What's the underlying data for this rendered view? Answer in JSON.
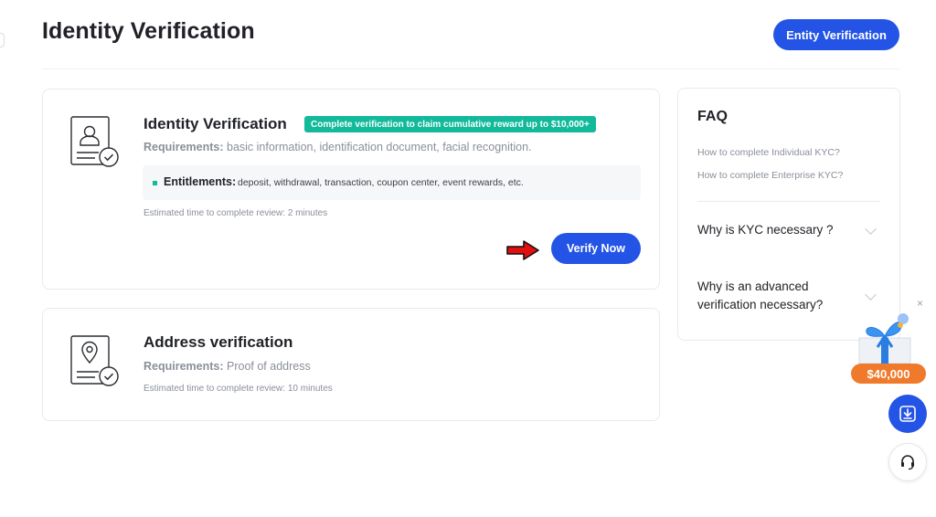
{
  "header": {
    "title": "Identity Verification",
    "entity_button": "Entity Verification"
  },
  "identity_card": {
    "title": "Identity Verification",
    "badge": "Complete verification to claim cumulative reward up to $10,000+",
    "requirements_label": "Requirements:",
    "requirements_value": " basic information, identification document, facial recognition.",
    "entitlements_label": "Entitlements:",
    "entitlements_value": "deposit, withdrawal, transaction, coupon center, event rewards, etc.",
    "estimated_time": "Estimated time to complete review: 2 minutes",
    "verify_button": "Verify Now"
  },
  "address_card": {
    "title": "Address verification",
    "requirements_label": "Requirements:",
    "requirements_value": " Proof of address",
    "estimated_time": "Estimated time to complete review: 10 minutes"
  },
  "faq": {
    "title": "FAQ",
    "links": [
      "How to complete Individual KYC?",
      "How to complete Enterprise KYC?"
    ],
    "questions": [
      "Why is KYC necessary ?",
      "Why is an advanced verification necessary?"
    ]
  },
  "promo": {
    "amount": "$40,000",
    "close": "×"
  },
  "icons": {
    "id_doc": "id-document-check-icon",
    "address_doc": "location-document-check-icon",
    "arrow": "red-right-arrow-icon",
    "gift": "gift-box-icon",
    "download": "download-icon",
    "support": "headset-icon"
  },
  "colors": {
    "primary": "#2454e6",
    "accent_green": "#12b99a",
    "promo_orange": "#f07a2b",
    "arrow_red": "#e01010"
  }
}
